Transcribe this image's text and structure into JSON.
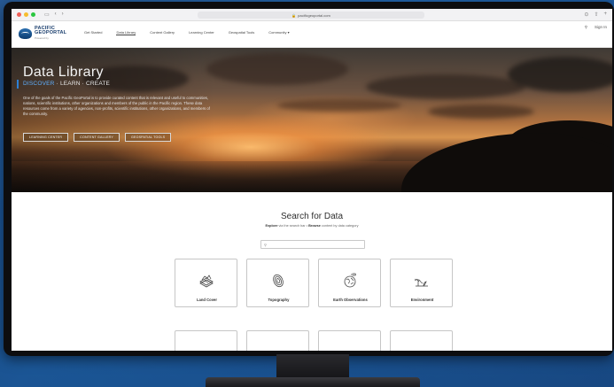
{
  "browser": {
    "url": "pacificgeoportal.com"
  },
  "site": {
    "logo_line1": "PACIFIC",
    "logo_line2": "GEOPORTAL",
    "logo_tagline": "Powered by",
    "nav": [
      {
        "label": "Get Started"
      },
      {
        "label": "Data Library"
      },
      {
        "label": "Content Gallery"
      },
      {
        "label": "Learning Center"
      },
      {
        "label": "Geospatial Tools"
      },
      {
        "label": "Community ▾"
      }
    ],
    "sign_in": "Sign In"
  },
  "hero": {
    "title": "Data Library",
    "subtitle_discover": "DISCOVER",
    "subtitle_rest": " · LEARN · CREATE",
    "description": "One of the goals of the Pacific GeoPortal is to provide curated content that is relevant and useful to communities, nations, scientific institutions, other organizations and members of the public in the Pacific region. These data resources come from a variety of agencies, non-profits, scientific institutions, other organizations, and members of the community.",
    "buttons": [
      {
        "label": "LEARNING CENTER"
      },
      {
        "label": "CONTENT GALLERY"
      },
      {
        "label": "GEOSPATIAL TOOLS"
      }
    ]
  },
  "search": {
    "title": "Search for Data",
    "sub_explore": "Explore",
    "sub_mid": " via the search bar  •  ",
    "sub_browse": "Browse",
    "sub_end": " content by data category",
    "placeholder": ""
  },
  "categories": [
    {
      "label": "Land Cover",
      "icon": "land-cover-icon"
    },
    {
      "label": "Topography",
      "icon": "topography-icon"
    },
    {
      "label": "Earth Observations",
      "icon": "earth-observations-icon"
    },
    {
      "label": "Environment",
      "icon": "environment-icon"
    }
  ]
}
